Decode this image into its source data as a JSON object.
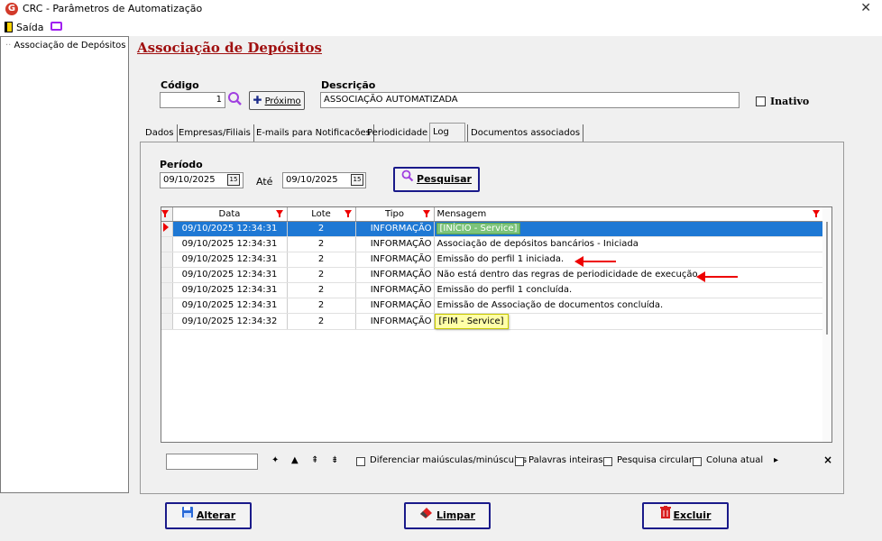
{
  "window": {
    "title": "CRC - Parâmetros de Automatização",
    "logo_letter": "G"
  },
  "menu": {
    "exit": "Saída"
  },
  "tree": {
    "items": [
      "Associação de Depósitos"
    ]
  },
  "page": {
    "title": "Associação de Depósitos"
  },
  "form": {
    "codigo_label": "Código",
    "codigo_value": "1",
    "next_button": "Próximo",
    "descricao_label": "Descrição",
    "descricao_value": "ASSOCIAÇÃO AUTOMATIZADA",
    "inativo_label": "Inativo"
  },
  "tabs": [
    "Dados",
    "Empresas/Filiais",
    "E-mails para Notificacões",
    "Periodicidade",
    "Log",
    "Documentos associados"
  ],
  "log": {
    "periodo_label": "Período",
    "from_date": "09/10/2025",
    "ate_label": "Até",
    "to_date": "09/10/2025",
    "search_button": "Pesquisar",
    "columns": [
      "Data",
      "Lote",
      "Tipo",
      "Mensagem"
    ],
    "rows": [
      {
        "data": "09/10/2025 12:34:31",
        "lote": "2",
        "tipo": "INFORMAÇÃO",
        "mensagem": "[INÍCIO - Service]"
      },
      {
        "data": "09/10/2025 12:34:31",
        "lote": "2",
        "tipo": "INFORMAÇÃO",
        "mensagem": "Associação de depósitos bancários - Iniciada"
      },
      {
        "data": "09/10/2025 12:34:31",
        "lote": "2",
        "tipo": "INFORMAÇÃO",
        "mensagem": "Emissão do perfil 1 iniciada."
      },
      {
        "data": "09/10/2025 12:34:31",
        "lote": "2",
        "tipo": "INFORMAÇÃO",
        "mensagem": "Não está dentro das regras de periodicidade de execução."
      },
      {
        "data": "09/10/2025 12:34:31",
        "lote": "2",
        "tipo": "INFORMAÇÃO",
        "mensagem": "Emissão do perfil 1 concluída."
      },
      {
        "data": "09/10/2025 12:34:31",
        "lote": "2",
        "tipo": "INFORMAÇÃO",
        "mensagem": "Emissão de Associação de documentos concluída."
      },
      {
        "data": "09/10/2025 12:34:32",
        "lote": "2",
        "tipo": "INFORMAÇÃO",
        "mensagem": "[FIM - Service]"
      }
    ]
  },
  "search_options": {
    "case": "Diferenciar maiúsculas/minúsculas",
    "whole": "Palavras inteiras",
    "circular": "Pesquisa circular",
    "current_col": "Coluna atual",
    "close": "×"
  },
  "buttons": {
    "alterar": "Alterar",
    "limpar": "Limpar",
    "excluir": "Excluir"
  },
  "colors": {
    "selection": "#1e78d4",
    "accent_red": "#a01010",
    "annotation_arrow": "#e00000",
    "highlight_yellow": "#ffffa8"
  }
}
